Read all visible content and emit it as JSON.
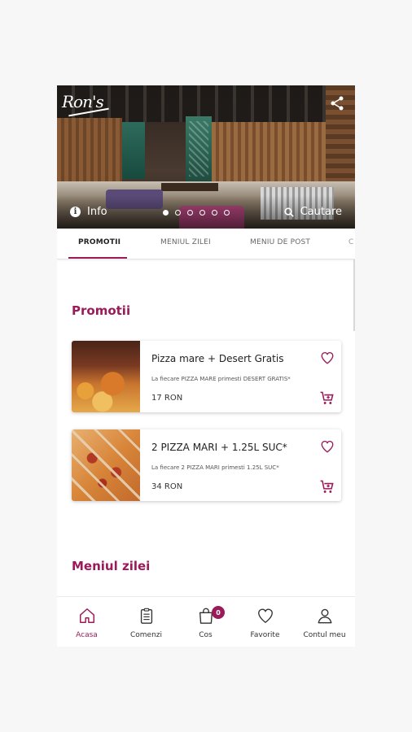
{
  "hero": {
    "logo_text": "Ron's",
    "info_label": "Info",
    "search_label": "Cautare",
    "slides_total": 6,
    "slide_active": 1
  },
  "tabs": [
    {
      "label": "PROMOTII",
      "active": true
    },
    {
      "label": "MENIUL ZILEI",
      "active": false
    },
    {
      "label": "MENIU DE POST",
      "active": false
    }
  ],
  "sections": {
    "promotii_title": "Promotii",
    "meniul_zilei_title": "Meniul zilei"
  },
  "promotions": [
    {
      "title": "Pizza mare + Desert Gratis",
      "description": "La fiecare PIZZA MARE primesti DESERT GRATIS*",
      "price": "17 RON"
    },
    {
      "title": "2 PIZZA MARI + 1.25L SUC*",
      "description": "La fiecare 2 PIZZA MARI primesti 1.25L SUC*",
      "price": "34 RON"
    }
  ],
  "bottom_nav": [
    {
      "label": "Acasa",
      "icon": "home-icon",
      "active": true
    },
    {
      "label": "Comenzi",
      "icon": "clipboard-icon",
      "active": false
    },
    {
      "label": "Cos",
      "icon": "shopping-bag-icon",
      "active": false,
      "badge": "0"
    },
    {
      "label": "Favorite",
      "icon": "heart-icon",
      "active": false
    },
    {
      "label": "Contul meu",
      "icon": "user-icon",
      "active": false
    }
  ],
  "colors": {
    "accent": "#9b1b5a",
    "background": "#f7f7f7",
    "surface": "#ffffff"
  }
}
